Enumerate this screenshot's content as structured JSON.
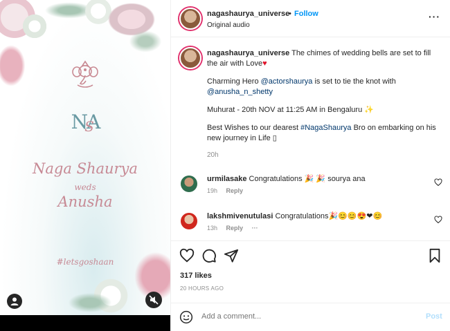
{
  "media": {
    "name_groom": "Naga Shaurya",
    "weds": "weds",
    "name_bride": "Anusha",
    "hashtag": "#letsgoshaan",
    "monogram_a": "N",
    "monogram_b": "A",
    "monogram_c": "S",
    "tag_icon": "user-tag-icon",
    "mute_icon": "mute-icon"
  },
  "header": {
    "username": "nagashaurya_universe",
    "separator": "•",
    "follow_label": "Follow",
    "audio": "Original audio",
    "more_label": "···"
  },
  "caption": {
    "username": "nagashaurya_universe",
    "line1": "The chimes of wedding bells are set to fill the air with Love",
    "heart": "♥",
    "p2_a": "Charming Hero ",
    "p2_mention1": "@actorshaurya",
    "p2_b": " is set to tie the knot with ",
    "p2_mention2": "@anusha_n_shetty",
    "p3": "Muhurat - 20th NOV at 11:25 AM in Bengaluru",
    "p3_emoji": "✨",
    "p4_a": "Best Wishes to our dearest ",
    "p4_tag": "#NagaShaurya",
    "p4_b": " Bro on embarking on his new journey in Life ",
    "p4_box": "▯",
    "time": "20h"
  },
  "comments": [
    {
      "username": "urmilasake",
      "text": "Congratulations",
      "emoji": "🎉 🎉",
      "tail": "sourya ana",
      "time": "19h",
      "reply": "Reply",
      "more": ""
    },
    {
      "username": "lakshmivenutulasi",
      "text": "Congratulations",
      "emoji": "🎉😊😊😍❤😊",
      "tail": "",
      "time": "13h",
      "reply": "Reply",
      "more": "···"
    }
  ],
  "actions": {
    "like_icon": "heart-icon",
    "comment_icon": "comment-icon",
    "share_icon": "share-icon",
    "save_icon": "bookmark-icon",
    "likes": "317 likes",
    "ago": "20 HOURS AGO"
  },
  "add_comment": {
    "placeholder": "Add a comment...",
    "post_label": "Post"
  },
  "colors": {
    "follow": "#0095f6",
    "mention": "#00376b",
    "post_disabled": "#b2dffc",
    "invite_pink": "#c78a95",
    "monogram_teal": "#6a9aa3"
  }
}
